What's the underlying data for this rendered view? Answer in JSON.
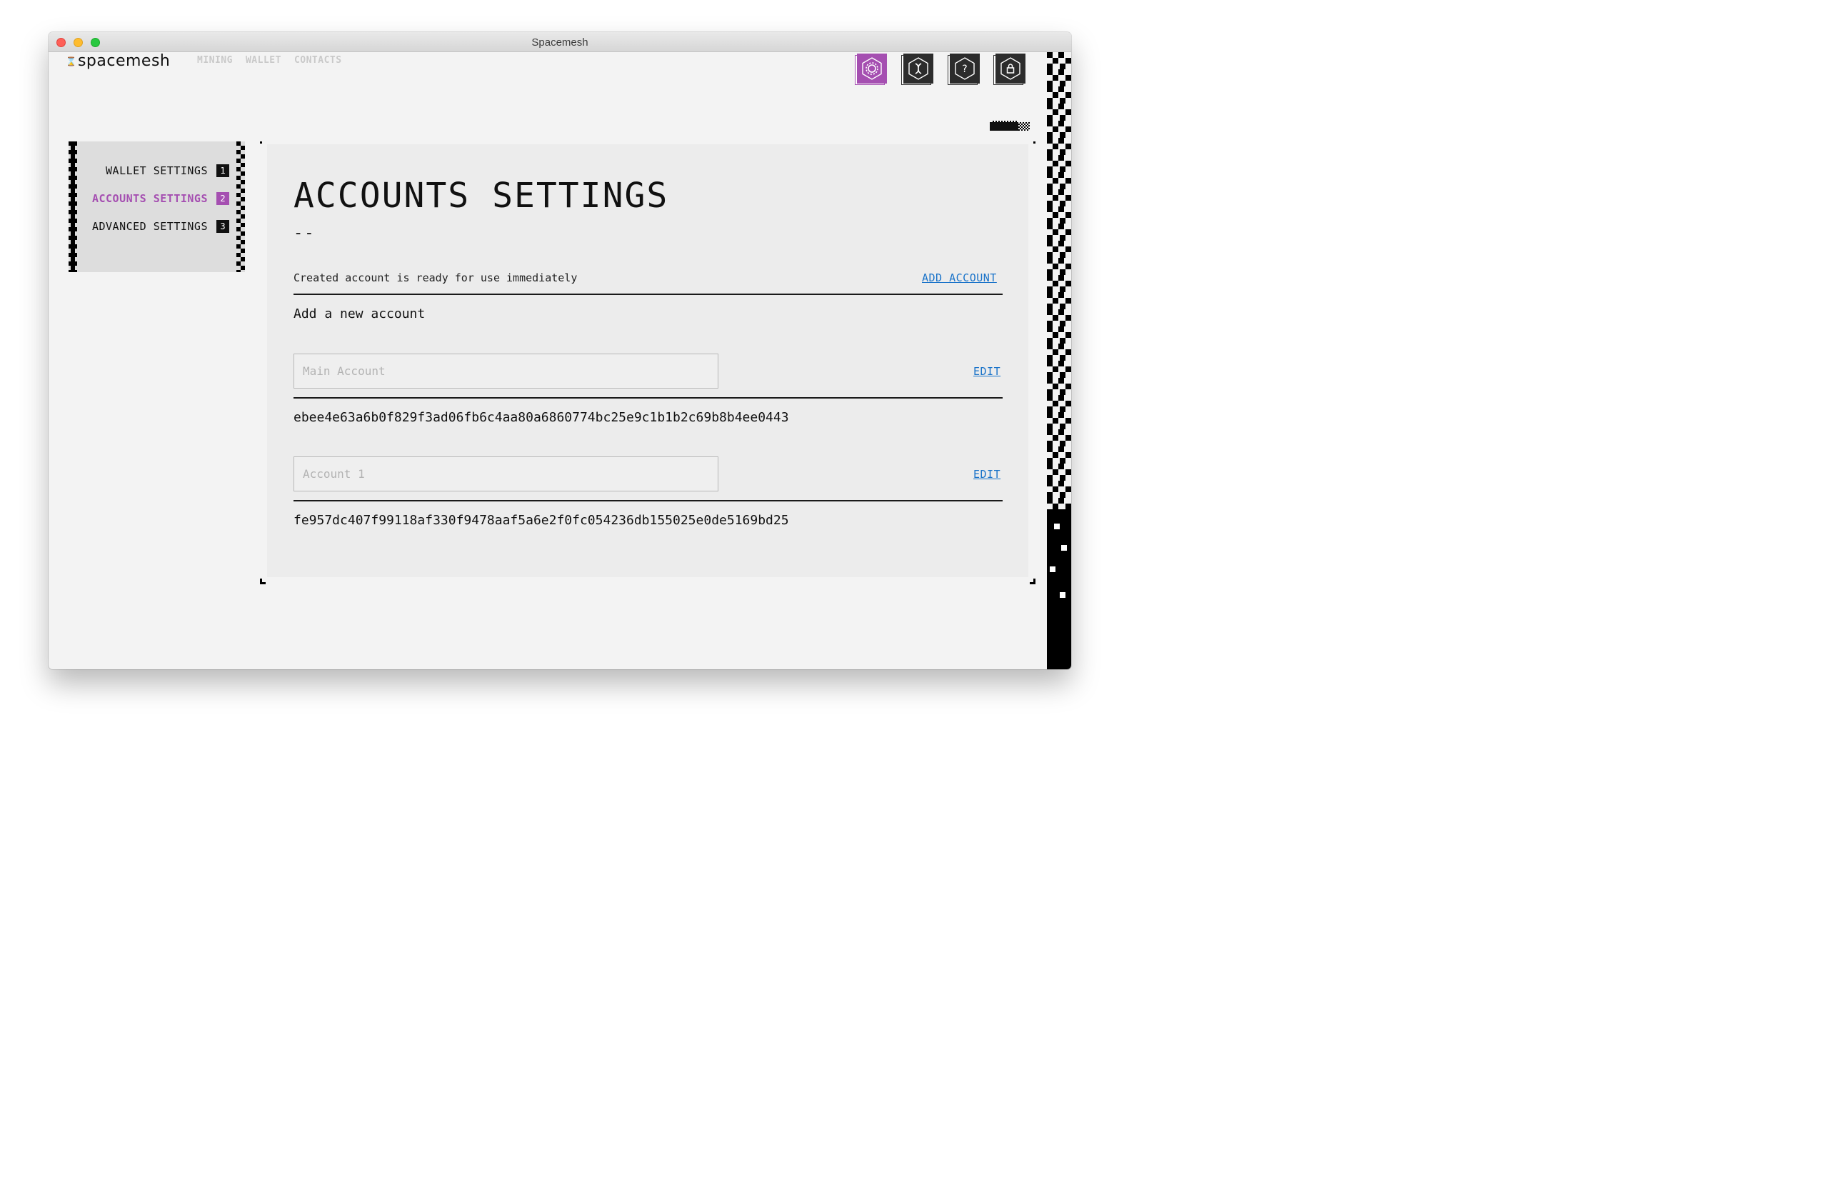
{
  "window": {
    "title": "Spacemesh"
  },
  "header": {
    "logo_icon": "⌛",
    "logo_text": "spacemesh",
    "nav": [
      "MINING",
      "WALLET",
      "CONTACTS"
    ],
    "icons": [
      {
        "name": "settings-icon",
        "active": true
      },
      {
        "name": "dna-icon",
        "active": false
      },
      {
        "name": "help-icon",
        "active": false
      },
      {
        "name": "lock-icon",
        "active": false
      }
    ]
  },
  "colors": {
    "accent": "#a54fb1",
    "link": "#1a73c9",
    "dark": "#2c2c2c"
  },
  "sidebar": {
    "items": [
      {
        "label": "WALLET SETTINGS",
        "num": "1",
        "active": false
      },
      {
        "label": "ACCOUNTS SETTINGS",
        "num": "2",
        "active": true
      },
      {
        "label": "ADVANCED SETTINGS",
        "num": "3",
        "active": false
      }
    ]
  },
  "main": {
    "title": "ACCOUNTS SETTINGS",
    "dash": "--",
    "info": "Created account is ready for use immediately",
    "add_account_label": "ADD ACCOUNT",
    "sub_heading": "Add a new account",
    "accounts": [
      {
        "placeholder": "Main Account",
        "edit_label": "EDIT",
        "key": "ebee4e63a6b0f829f3ad06fb6c4aa80a6860774bc25e9c1b1b2c69b8b4ee0443"
      },
      {
        "placeholder": "Account 1",
        "edit_label": "EDIT",
        "key": "fe957dc407f99118af330f9478aaf5a6e2f0fc054236db155025e0de5169bd25"
      }
    ]
  }
}
